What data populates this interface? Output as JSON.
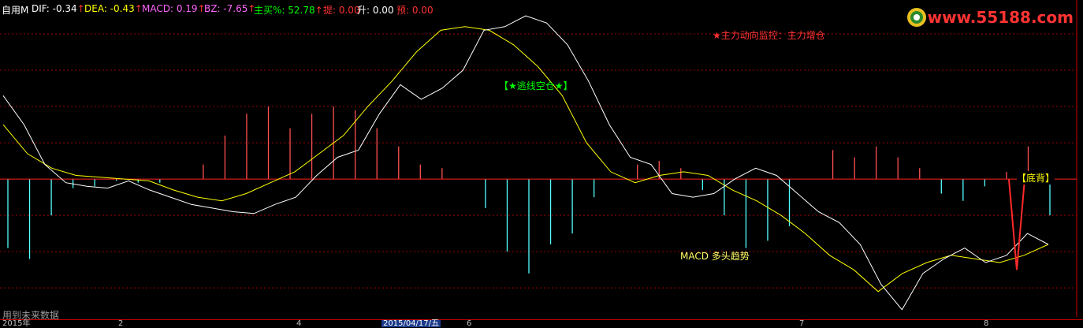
{
  "header": {
    "title": "自用M",
    "items": [
      {
        "label": "DIF: -0.34",
        "arrow": "↑",
        "color": "#ffffff"
      },
      {
        "label": "DEA: -0.43",
        "arrow": "↑",
        "color": "#ffff00"
      },
      {
        "label": "MACD: 0.19",
        "arrow": "↑",
        "color": "#ff66ff"
      },
      {
        "label": "BZ: -7.65",
        "arrow": "↑",
        "color": "#ff66ff"
      },
      {
        "label": "主买%: 52.78",
        "arrow": "↑",
        "color": "#00ff00"
      },
      {
        "label": "提: 0.00",
        "arrow": "",
        "color": "#ff3333"
      },
      {
        "label": "升: 0.00",
        "arrow": "",
        "color": "#ffffff"
      },
      {
        "label": "预: 0.00",
        "arrow": "",
        "color": "#ff3333"
      }
    ]
  },
  "logo": {
    "text": "www.55188.com"
  },
  "annotations": {
    "monitor": "★主力动向监控：主力增仓",
    "escape": "【★逃线空仓★】",
    "trend": "MACD 多头趋势",
    "divergence": "【底背】",
    "future": "用到未来数据"
  },
  "x_axis": {
    "date_label": "2015/04/17/五",
    "ticks": [
      "2015年",
      "2",
      "4",
      "6",
      "7",
      "8"
    ]
  },
  "colors": {
    "up_bar": "#ff5050",
    "down_bar": "#54ffff",
    "dif": "#ffffff",
    "dea": "#ffff00",
    "grid": "#990000",
    "zero_line": "#ff2222"
  },
  "chart_data": {
    "type": "line",
    "indicator": "MACD",
    "ylim": [
      -3.8,
      4.5
    ],
    "series": [
      {
        "name": "DIF",
        "values": [
          2.3,
          1.5,
          0.4,
          -0.1,
          -0.2,
          -0.25,
          -0.05,
          -0.3,
          -0.5,
          -0.7,
          -0.8,
          -0.9,
          -0.95,
          -0.7,
          -0.5,
          0.1,
          0.6,
          0.8,
          1.8,
          2.6,
          2.2,
          2.5,
          3.0,
          4.1,
          4.2,
          4.5,
          4.3,
          3.7,
          2.7,
          1.5,
          0.6,
          0.4,
          -0.4,
          -0.5,
          -0.4,
          0.0,
          0.3,
          0.1,
          -0.4,
          -0.9,
          -1.2,
          -1.8,
          -2.9,
          -3.6,
          -2.6,
          -2.2,
          -1.9,
          -2.3,
          -2.1,
          -1.5,
          -1.8
        ]
      },
      {
        "name": "DEA",
        "values": [
          1.5,
          0.7,
          0.3,
          0.1,
          0.05,
          0.0,
          -0.05,
          -0.3,
          -0.5,
          -0.6,
          -0.4,
          -0.1,
          0.2,
          0.7,
          1.2,
          2.0,
          2.7,
          3.5,
          4.1,
          4.2,
          4.1,
          3.7,
          3.1,
          2.3,
          1.0,
          0.2,
          -0.1,
          0.1,
          0.2,
          0.1,
          -0.3,
          -0.6,
          -1.0,
          -1.5,
          -2.1,
          -2.5,
          -3.1,
          -2.6,
          -2.3,
          -2.1,
          -2.2,
          -2.3,
          -2.1,
          -1.8
        ]
      },
      {
        "name": "MACD",
        "values": [
          -1.9,
          -2.2,
          -1.0,
          -0.25,
          -0.2,
          -0.05,
          -0.1,
          -0.1,
          0.0,
          0.4,
          1.2,
          1.8,
          2.0,
          1.4,
          1.8,
          2.0,
          1.9,
          1.4,
          0.9,
          0.4,
          0.3,
          0.0,
          -0.8,
          -2.0,
          -2.6,
          -1.8,
          -1.5,
          -0.5,
          0.0,
          0.4,
          0.5,
          0.3,
          -0.3,
          -1.0,
          -1.9,
          -1.7,
          -1.3,
          0.0,
          0.8,
          0.6,
          0.9,
          0.6,
          0.3,
          -0.4,
          -0.6,
          -0.2,
          0.2,
          0.9,
          -1.0
        ]
      }
    ],
    "histogram_x": "bars",
    "grid": true
  }
}
